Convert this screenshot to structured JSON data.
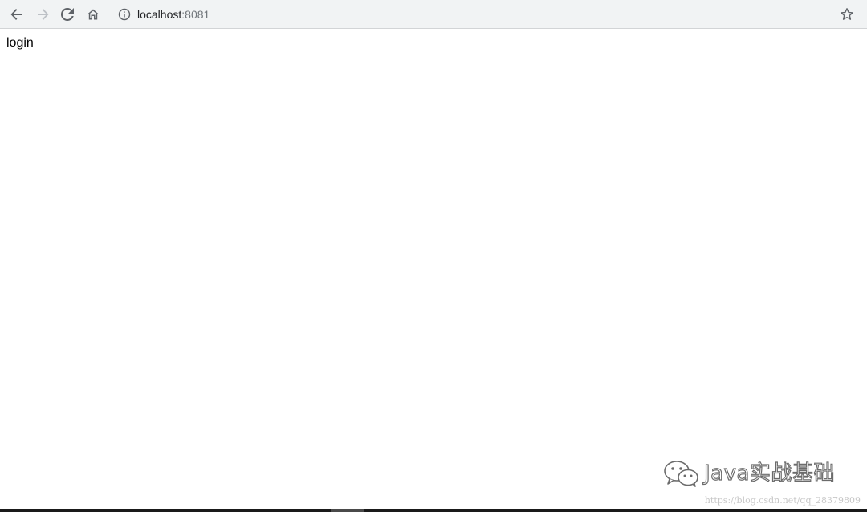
{
  "browser": {
    "nav": {
      "back_icon": "arrow-left-icon",
      "forward_icon": "arrow-right-icon",
      "reload_icon": "reload-icon",
      "home_icon": "home-icon"
    },
    "omnibox": {
      "info_icon": "info-icon",
      "url_host": "localhost",
      "url_port": ":8081",
      "bookmark_icon": "star-icon"
    },
    "colors": {
      "toolbar_bg": "#f1f3f4",
      "icon_active": "#5f6368",
      "icon_disabled": "#bdc1c6",
      "url_host": "#202124",
      "url_port": "#70757a"
    }
  },
  "page": {
    "text": "login"
  },
  "watermark": {
    "brand_text": "Java实战基础",
    "url_text": "https://blog.csdn.net/qq_28379809",
    "logo_icon": "wechat-icon"
  }
}
